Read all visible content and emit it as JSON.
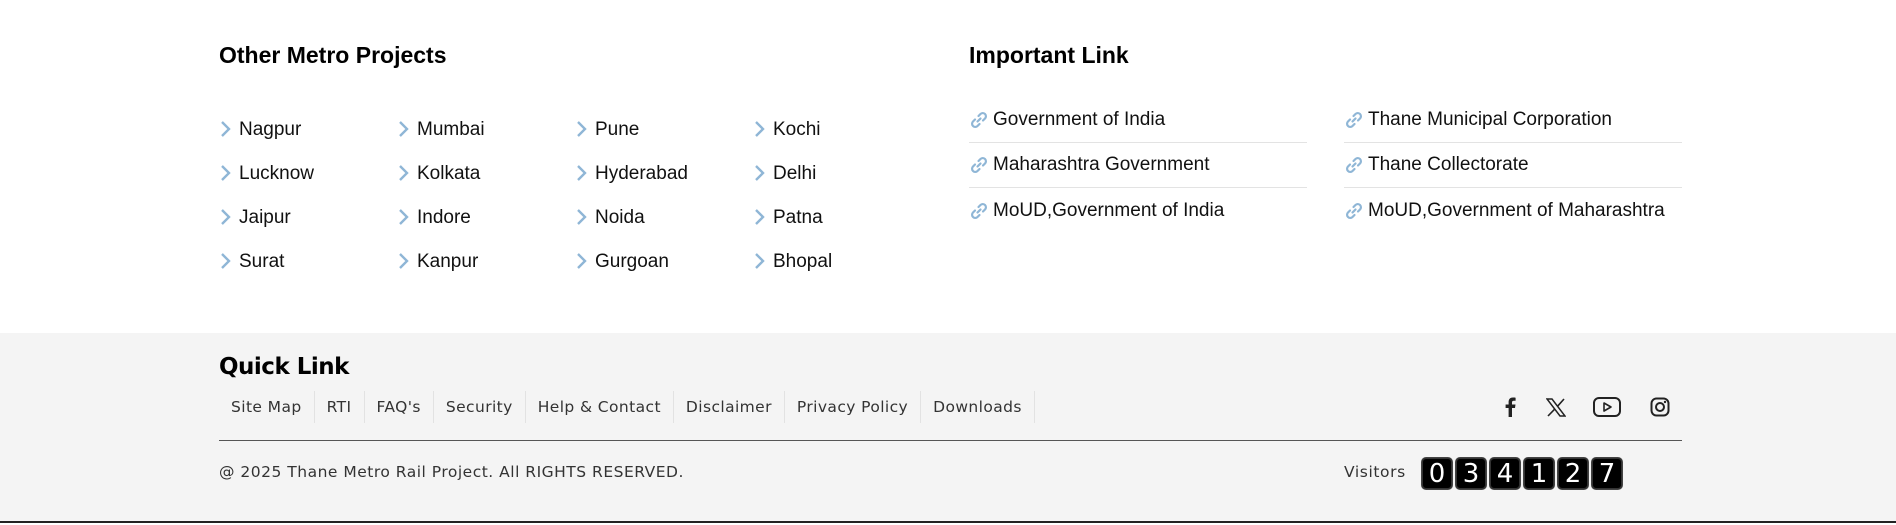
{
  "other_metro": {
    "title": "Other Metro Projects",
    "columns": [
      [
        "Nagpur",
        "Lucknow",
        "Jaipur",
        "Surat"
      ],
      [
        "Mumbai",
        "Kolkata",
        "Indore",
        "Kanpur"
      ],
      [
        "Pune",
        "Hyderabad",
        "Noida",
        "Gurgoan"
      ],
      [
        "Kochi",
        "Delhi",
        "Patna",
        "Bhopal"
      ]
    ]
  },
  "important": {
    "title": "Important Link",
    "columns": [
      [
        "Government of India",
        "Maharashtra Government",
        "MoUD,Government of India"
      ],
      [
        "Thane Municipal Corporation",
        "Thane Collectorate",
        "MoUD,Government of Maharashtra"
      ]
    ]
  },
  "footer": {
    "quick_link_title": "Quick Link",
    "quick_links": [
      "Site Map",
      "RTI",
      "FAQ's",
      "Security",
      "Help & Contact",
      "Disclaimer",
      "Privacy Policy",
      "Downloads"
    ],
    "social_icons": [
      "facebook-icon",
      "x-twitter-icon",
      "youtube-icon",
      "instagram-icon"
    ],
    "copyright": "@ 2025 Thane Metro Rail Project. All RIGHTS RESERVED.",
    "visitors_label": "Visitors",
    "visitor_digits": [
      "0",
      "3",
      "4",
      "1",
      "2",
      "7"
    ]
  },
  "colors": {
    "chevron": "#8fb6d6",
    "footer_bg": "#f4f4f4"
  }
}
